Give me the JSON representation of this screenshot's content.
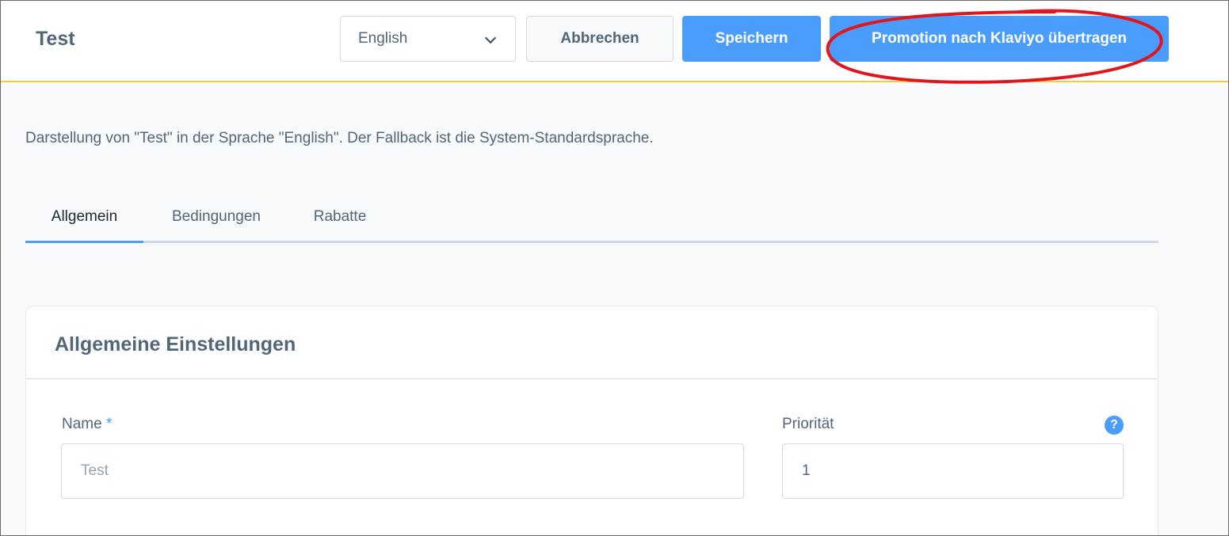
{
  "header": {
    "title": "Test",
    "language_select": {
      "value": "English",
      "icon": "chevron-down-icon"
    },
    "cancel_label": "Abbrechen",
    "save_label": "Speichern",
    "push_label": "Promotion nach Klaviyo übertragen"
  },
  "description": "Darstellung von \"Test\" in der Sprache \"English\". Der Fallback ist die System-Standardsprache.",
  "tabs": [
    {
      "label": "Allgemein",
      "active": true
    },
    {
      "label": "Bedingungen",
      "active": false
    },
    {
      "label": "Rabatte",
      "active": false
    }
  ],
  "card": {
    "title": "Allgemeine Einstellungen",
    "name_field": {
      "label": "Name",
      "required_mark": "*",
      "placeholder": "Test",
      "value": ""
    },
    "priority_field": {
      "label": "Priorität",
      "value": "1",
      "help_icon": "?"
    }
  },
  "colors": {
    "accent": "#4a9dfa",
    "header_border": "#f2cd3a",
    "annotation": "#e0161e"
  }
}
